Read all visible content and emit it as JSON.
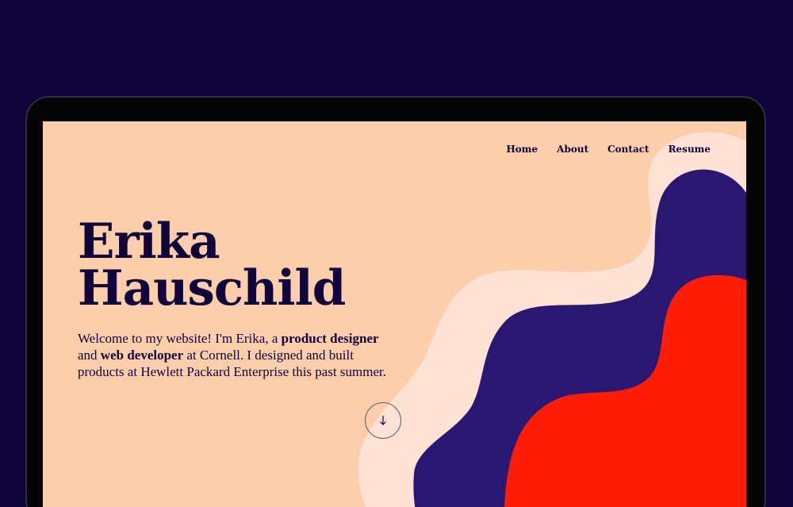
{
  "colors": {
    "background": "#10023a",
    "page": "#fdceac",
    "blob_light": "#fee2d4",
    "blob_navy": "#2a1772",
    "blob_red": "#ff1e05",
    "text": "#10023a"
  },
  "nav": {
    "items": [
      {
        "label": "Home"
      },
      {
        "label": "About"
      },
      {
        "label": "Contact"
      },
      {
        "label": "Resume"
      }
    ]
  },
  "hero": {
    "name_line1": "Erika",
    "name_line2": "Hauschild",
    "intro": {
      "part1": "Welcome to my website! I'm Erika, a ",
      "bold1": "product designer",
      "part2": " and ",
      "bold2": "web developer",
      "part3": " at Cornell. I designed and built products at Hewlett Packard Enterprise this past summer."
    },
    "scroll_icon": "arrow-down-icon"
  }
}
